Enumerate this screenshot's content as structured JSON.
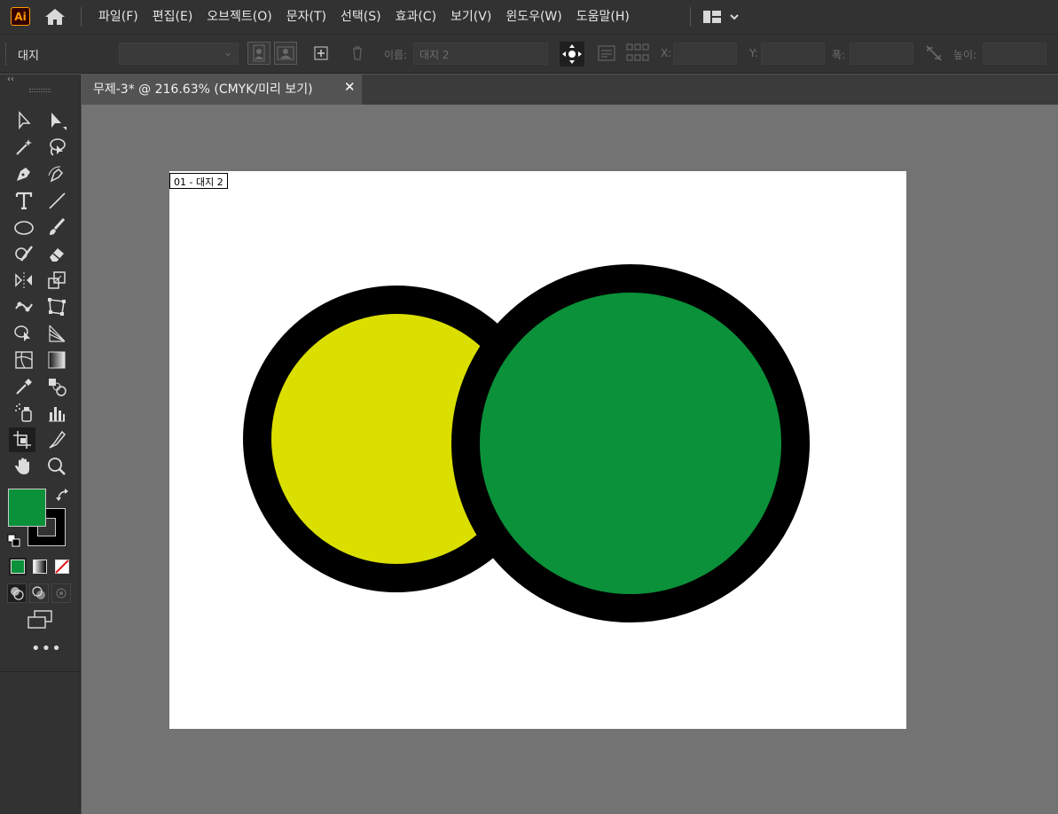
{
  "app": {
    "logo_text": "Ai"
  },
  "menu": {
    "items": [
      "파일(F)",
      "편집(E)",
      "오브젝트(O)",
      "문자(T)",
      "선택(S)",
      "효과(C)",
      "보기(V)",
      "윈도우(W)",
      "도움말(H)"
    ]
  },
  "control_bar": {
    "label": "대지",
    "name_label": "이름:",
    "name_value": "대지 2",
    "x_label": "X:",
    "y_label": "Y:",
    "width_label": "폭:",
    "height_label": "높이:"
  },
  "document": {
    "tab_title": "무제-3* @ 216.63% (CMYK/미리 보기)",
    "artboard_label": "01 - 대지 2"
  },
  "colors": {
    "fill": "#0a9139",
    "stroke": "#000000",
    "circle_left_fill": "#dbdf00",
    "circle_right_fill": "#0a9139"
  },
  "tools": [
    "selection-tool",
    "direct-selection-tool",
    "magic-wand-tool",
    "lasso-tool",
    "pen-tool",
    "curvature-tool",
    "type-tool",
    "line-segment-tool",
    "ellipse-tool",
    "paintbrush-tool",
    "shaper-tool",
    "eraser-tool",
    "reflect-tool",
    "scale-tool",
    "puppet-warp-tool",
    "free-transform-tool",
    "shape-builder-tool",
    "perspective-grid-tool",
    "mesh-tool",
    "gradient-tool",
    "eyedropper-tool",
    "blend-tool",
    "symbol-sprayer-tool",
    "column-graph-tool",
    "artboard-tool",
    "slice-tool",
    "hand-tool",
    "zoom-tool"
  ]
}
